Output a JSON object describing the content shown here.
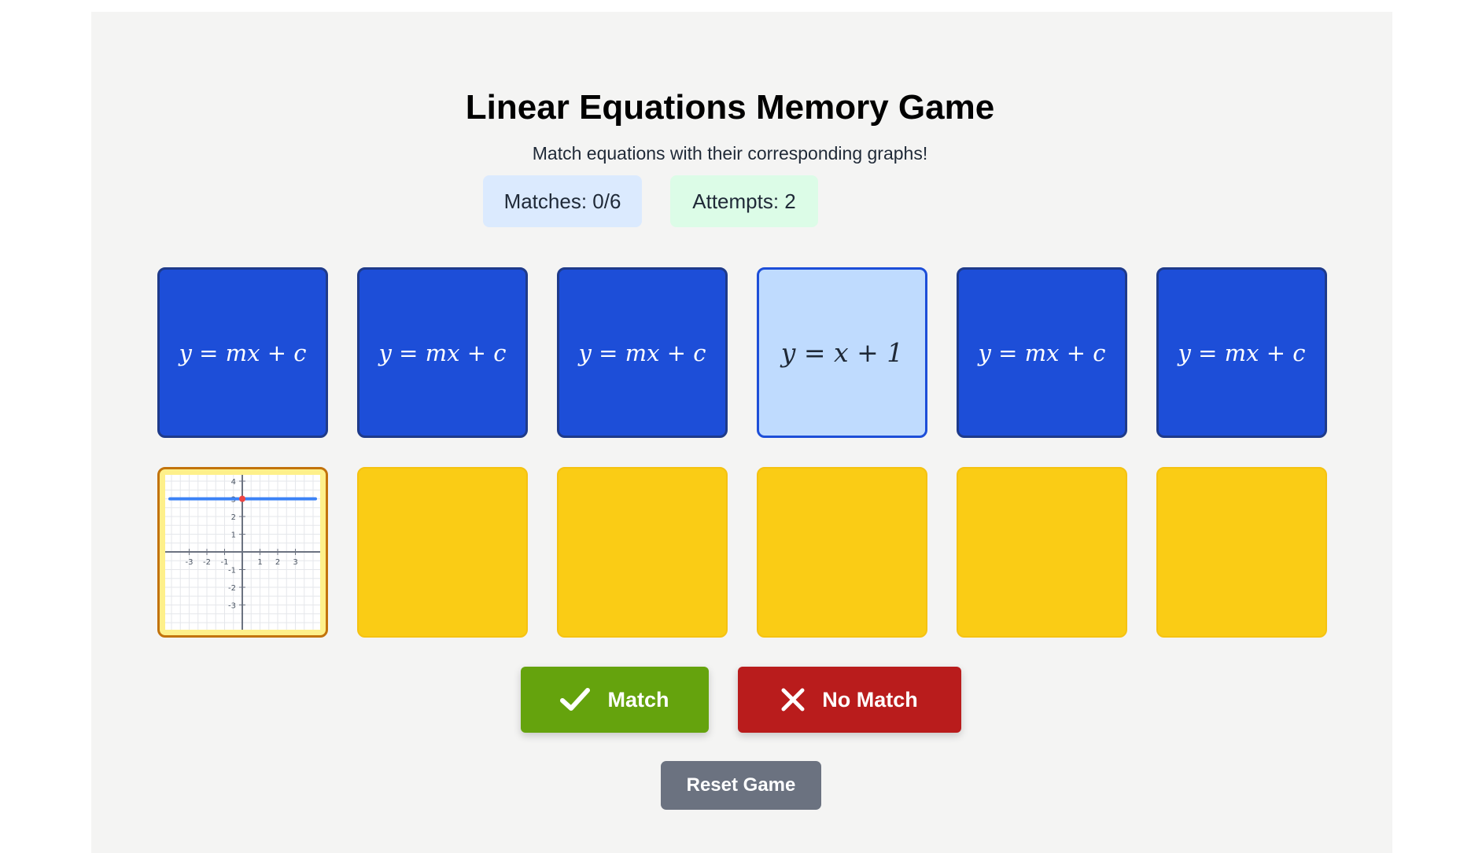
{
  "header": {
    "title": "Linear Equations Memory Game",
    "subtitle": "Match equations with their corresponding graphs!"
  },
  "stats": {
    "matches_label": "Matches: 0/6",
    "attempts_label": "Attempts: 2"
  },
  "equation_cards": [
    {
      "label": "y = mx + c",
      "state": "face-down"
    },
    {
      "label": "y = mx + c",
      "state": "face-down"
    },
    {
      "label": "y = mx + c",
      "state": "face-down"
    },
    {
      "label": "y = x + 1",
      "state": "flipped"
    },
    {
      "label": "y = mx + c",
      "state": "face-down"
    },
    {
      "label": "y = mx + c",
      "state": "face-down"
    }
  ],
  "graph_cards": [
    {
      "state": "flipped",
      "graph": {
        "x_ticks": [
          "-3",
          "-2",
          "-1",
          "1",
          "2",
          "3"
        ],
        "y_ticks": [
          "4",
          "3",
          "2",
          "1",
          "-1",
          "-2",
          "-3"
        ],
        "line": "y = 3",
        "highlight_point": [
          0,
          3
        ]
      }
    },
    {
      "state": "face-down"
    },
    {
      "state": "face-down"
    },
    {
      "state": "face-down"
    },
    {
      "state": "face-down"
    },
    {
      "state": "face-down"
    }
  ],
  "controls": {
    "match_label": "Match",
    "no_match_label": "No Match",
    "reset_label": "Reset Game"
  },
  "colors": {
    "card_back_equation": "#1d4ed8",
    "card_back_graph": "#facc15",
    "match_button": "#65a30d",
    "no_match_button": "#b91c1c",
    "reset_button": "#6b7280",
    "graph_line": "#3b82f6",
    "graph_point": "#ef4444"
  }
}
